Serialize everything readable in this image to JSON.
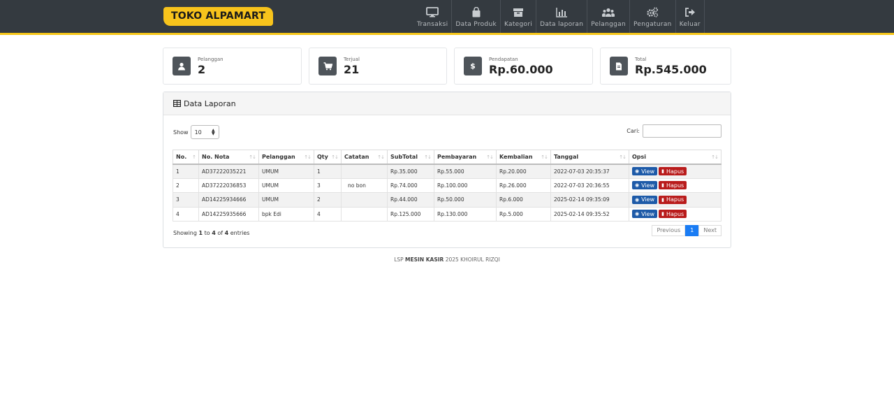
{
  "brand": "TOKO ALPAMART",
  "nav": [
    {
      "label": "Transaksi",
      "icon": "monitor-icon"
    },
    {
      "label": "Data Produk",
      "icon": "shopping-bag-icon"
    },
    {
      "label": "Kategori",
      "icon": "box-icon"
    },
    {
      "label": "Data laporan",
      "icon": "bar-chart-icon"
    },
    {
      "label": "Pelanggan",
      "icon": "users-icon"
    },
    {
      "label": "Pengaturan",
      "icon": "gears-icon"
    },
    {
      "label": "Keluar",
      "icon": "sign-out-icon"
    }
  ],
  "stats": [
    {
      "label": "Pelanggan",
      "value": "2",
      "icon": "user-icon"
    },
    {
      "label": "Terjual",
      "value": "21",
      "icon": "cart-icon"
    },
    {
      "label": "Pendapatan",
      "value": "Rp.60.000",
      "icon": "dollar-icon"
    },
    {
      "label": "Total",
      "value": "Rp.545.000",
      "icon": "document-icon"
    }
  ],
  "panel": {
    "title": "Data Laporan",
    "show_label": "Show",
    "show_value": "10",
    "search_label": "Cari:",
    "search_value": "",
    "columns": [
      "No.",
      "No. Nota",
      "Pelanggan",
      "Qty",
      "Catatan",
      "SubTotal",
      "Pembayaran",
      "Kembalian",
      "Tanggal",
      "Opsi"
    ],
    "rows": [
      {
        "no": "1",
        "nota": "AD37222035221",
        "pelanggan": "UMUM",
        "qty": "1",
        "catatan": "",
        "subtotal": "Rp.35.000",
        "pembayaran": "Rp.55.000",
        "kembalian": "Rp.20.000",
        "tanggal": "2022-07-03 20:35:37"
      },
      {
        "no": "2",
        "nota": "AD37222036853",
        "pelanggan": "UMUM",
        "qty": "3",
        "catatan": "no bon",
        "subtotal": "Rp.74.000",
        "pembayaran": "Rp.100.000",
        "kembalian": "Rp.26.000",
        "tanggal": "2022-07-03 20:36:55"
      },
      {
        "no": "3",
        "nota": "AD14225934666",
        "pelanggan": "UMUM",
        "qty": "2",
        "catatan": "",
        "subtotal": "Rp.44.000",
        "pembayaran": "Rp.50.000",
        "kembalian": "Rp.6.000",
        "tanggal": "2025-02-14 09:35:09"
      },
      {
        "no": "4",
        "nota": "AD14225935666",
        "pelanggan": "bpk Edi",
        "qty": "4",
        "catatan": "",
        "subtotal": "Rp.125.000",
        "pembayaran": "Rp.130.000",
        "kembalian": "Rp.5.000",
        "tanggal": "2025-02-14 09:35:52"
      }
    ],
    "view_label": "View",
    "delete_label": "Hapus",
    "info": {
      "prefix": "Showing",
      "from": "1",
      "to_word": "to",
      "to": "4",
      "of_word": "of",
      "total": "4",
      "suffix": "entries"
    },
    "pager": {
      "previous": "Previous",
      "current": "1",
      "next": "Next"
    }
  },
  "footer": {
    "prefix": "LSP",
    "bold": "MESIN KASIR",
    "suffix": "2025 KHOIRUL RIZQI"
  }
}
